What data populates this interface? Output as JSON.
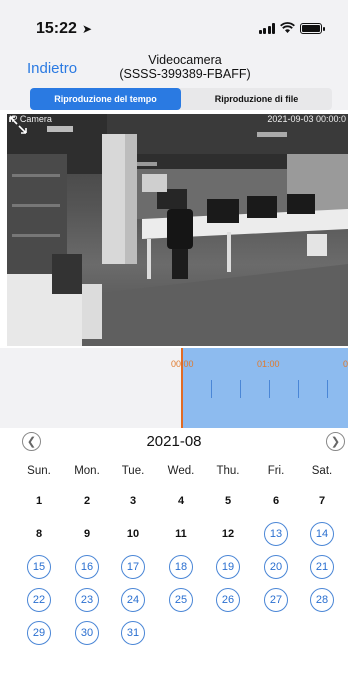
{
  "status_bar": {
    "time": "15:22",
    "location_icon": "location-arrow-icon",
    "signal_icon": "signal-bars-icon",
    "wifi_icon": "wifi-icon",
    "battery_icon": "battery-icon"
  },
  "nav": {
    "back_label": "Indietro",
    "title_line1": "Videocamera",
    "title_line2": "(SSSS-399389-FBAFF)"
  },
  "tabs": [
    {
      "label": "Riproduzione del tempo",
      "active": true
    },
    {
      "label": "Riproduzione di file",
      "active": false
    }
  ],
  "camera": {
    "label": "IP Camera",
    "timestamp": "2021-09-03 00:00:0",
    "expand_icon": "expand-icon"
  },
  "timeline": {
    "labels": [
      "00:00",
      "01:00"
    ],
    "accent": "#e06b24",
    "recorded_color": "#8dbbef"
  },
  "calendar": {
    "month": "2021-08",
    "prev_icon": "chevron-left-icon",
    "next_icon": "chevron-right-icon",
    "weekdays": [
      "Sun.",
      "Mon.",
      "Tue.",
      "Wed.",
      "Thu.",
      "Fri.",
      "Sat."
    ],
    "weeks": [
      [
        "1",
        "2",
        "3",
        "4",
        "5",
        "6",
        "7"
      ],
      [
        "8",
        "9",
        "10",
        "11",
        "12",
        "13",
        "14"
      ],
      [
        "15",
        "16",
        "17",
        "18",
        "19",
        "20",
        "21"
      ],
      [
        "22",
        "23",
        "24",
        "25",
        "26",
        "27",
        "28"
      ],
      [
        "29",
        "30",
        "31"
      ]
    ],
    "days_with_recordings": [
      "13",
      "14",
      "15",
      "16",
      "17",
      "18",
      "19",
      "20",
      "21",
      "22",
      "23",
      "24",
      "25",
      "26",
      "27",
      "28",
      "29",
      "30",
      "31"
    ],
    "highlight_color": "#4a86d6"
  }
}
